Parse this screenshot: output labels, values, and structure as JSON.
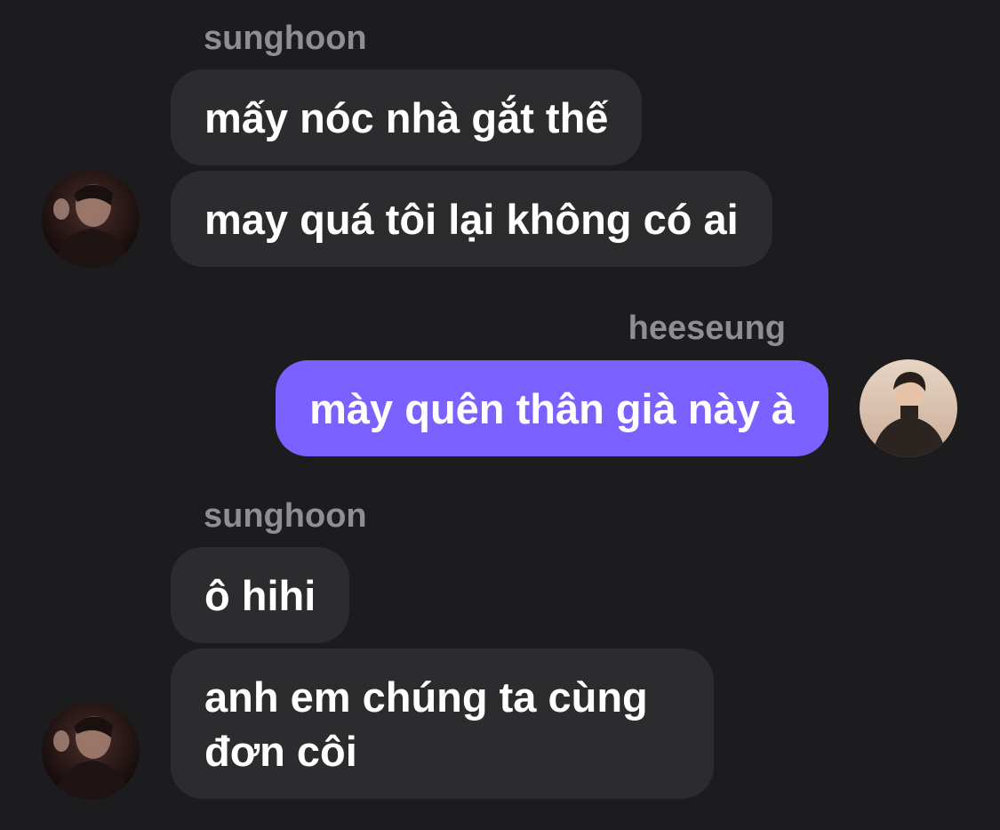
{
  "conversation": {
    "groups": [
      {
        "sender": "sunghoon",
        "direction": "incoming",
        "avatar": "sunghoon-avatar",
        "messages": [
          {
            "text": "mấy nóc nhà gắt thế"
          },
          {
            "text": "may quá tôi lại không có ai"
          }
        ]
      },
      {
        "sender": "heeseung",
        "direction": "outgoing",
        "avatar": "heeseung-avatar",
        "messages": [
          {
            "text": "mày quên thân già này à"
          }
        ]
      },
      {
        "sender": "sunghoon",
        "direction": "incoming",
        "avatar": "sunghoon-avatar",
        "messages": [
          {
            "text": "ô hihi"
          },
          {
            "text": "anh em chúng ta cùng đơn côi"
          }
        ]
      }
    ]
  },
  "colors": {
    "background": "#1c1c1e",
    "incoming_bubble": "#2c2c2e",
    "outgoing_bubble": "#7b61ff",
    "sender_name": "#8e8e93",
    "message_text": "#ffffff"
  }
}
